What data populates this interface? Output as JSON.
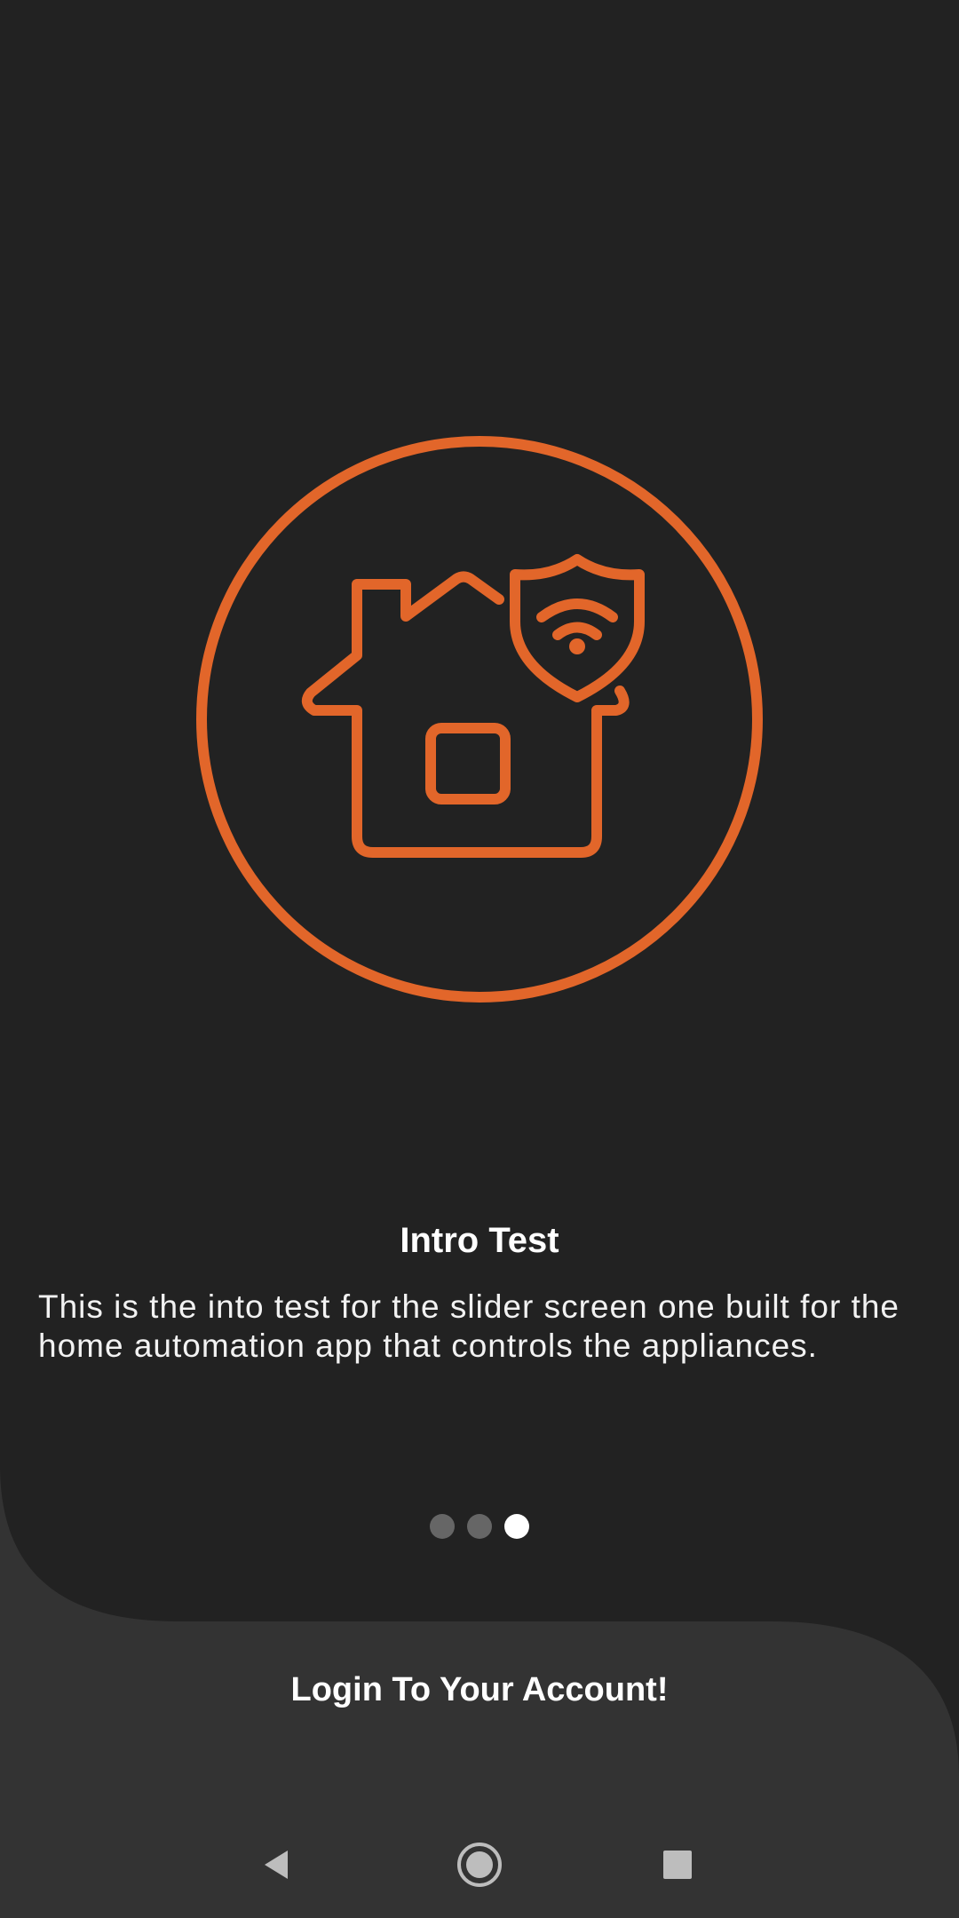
{
  "colors": {
    "background_top": "#222222",
    "background_bottom": "#333333",
    "accent": "#E2662A",
    "text": "#FFFFFF",
    "dot_inactive": "#666666",
    "dot_active": "#FFFFFF",
    "nav_icon": "#BDBDBD"
  },
  "hero": {
    "icon": "smart-home-security-icon"
  },
  "slide": {
    "title": "Intro Test",
    "body": "This is the into test for the slider screen one built for the home automation app that controls the appliances."
  },
  "pager": {
    "count": 3,
    "active_index": 2
  },
  "login": {
    "label": "Login To Your Account!"
  },
  "system_nav": {
    "back": "back-icon",
    "home": "home-icon",
    "recents": "recents-icon"
  }
}
